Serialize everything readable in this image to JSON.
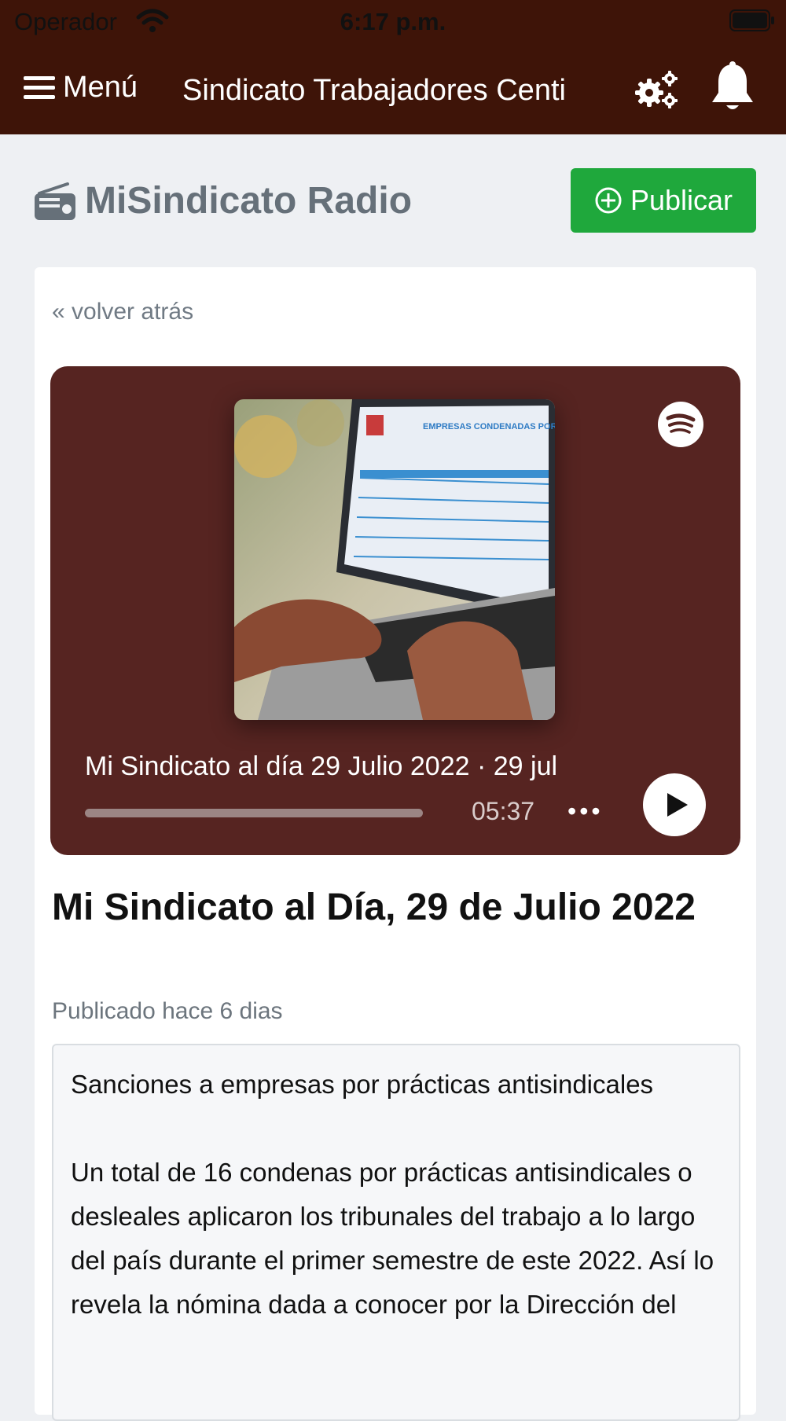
{
  "status_bar": {
    "carrier": "Operador",
    "time": "6:17 p.m.",
    "icons": [
      "wifi-icon",
      "battery-icon"
    ]
  },
  "nav": {
    "menu_label": "Menú",
    "title": "Sindicato Trabajadores Centi",
    "icons": [
      "hamburger-icon",
      "gears-icon",
      "bell-icon"
    ],
    "bg_color": "#3e1408"
  },
  "section": {
    "title": "MiSindicato Radio",
    "icon": "radio-icon",
    "publish_label": "Publicar",
    "publish_color": "#1fa83c"
  },
  "post": {
    "back_label": "« volver atrás",
    "player": {
      "episode_title": "Mi Sindicato al día 29 Julio 2022 · 29 jul",
      "duration": "05:37",
      "more": "•••",
      "cover_heading": "EMPRESAS CONDENADAS POR PRÁ",
      "icons": [
        "spotify-icon",
        "play-icon"
      ],
      "bg_color": "#562421"
    },
    "title": "Mi Sindicato al Día, 29 de Julio 2022",
    "published": "Publicado hace 6 dias",
    "body": [
      "Sanciones a empresas por prácticas antisindicales",
      "Un total de 16 condenas por prácticas antisindicales o desleales aplicaron los tribunales del trabajo a lo largo del país durante el primer semestre de este 2022. Así lo revela la nómina dada a conocer por la Dirección del"
    ]
  }
}
